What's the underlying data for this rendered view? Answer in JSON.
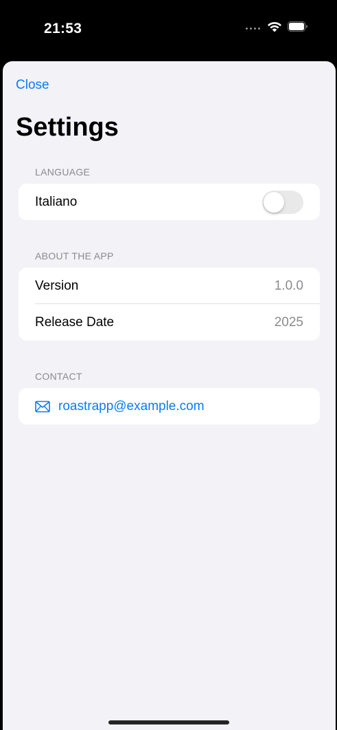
{
  "status_bar": {
    "time": "21:53"
  },
  "nav": {
    "close_label": "Close"
  },
  "page": {
    "title": "Settings"
  },
  "sections": {
    "language": {
      "header": "LANGUAGE",
      "toggle_label": "Italiano",
      "toggle_on": false
    },
    "about": {
      "header": "ABOUT THE APP",
      "rows": [
        {
          "label": "Version",
          "value": "1.0.0"
        },
        {
          "label": "Release Date",
          "value": "2025"
        }
      ]
    },
    "contact": {
      "header": "CONTACT",
      "email": "roastrapp@example.com",
      "icon": "envelope-icon"
    }
  },
  "colors": {
    "accent": "#0a7aff",
    "background": "#f2f2f7",
    "secondary_text": "#8a8a8e"
  }
}
